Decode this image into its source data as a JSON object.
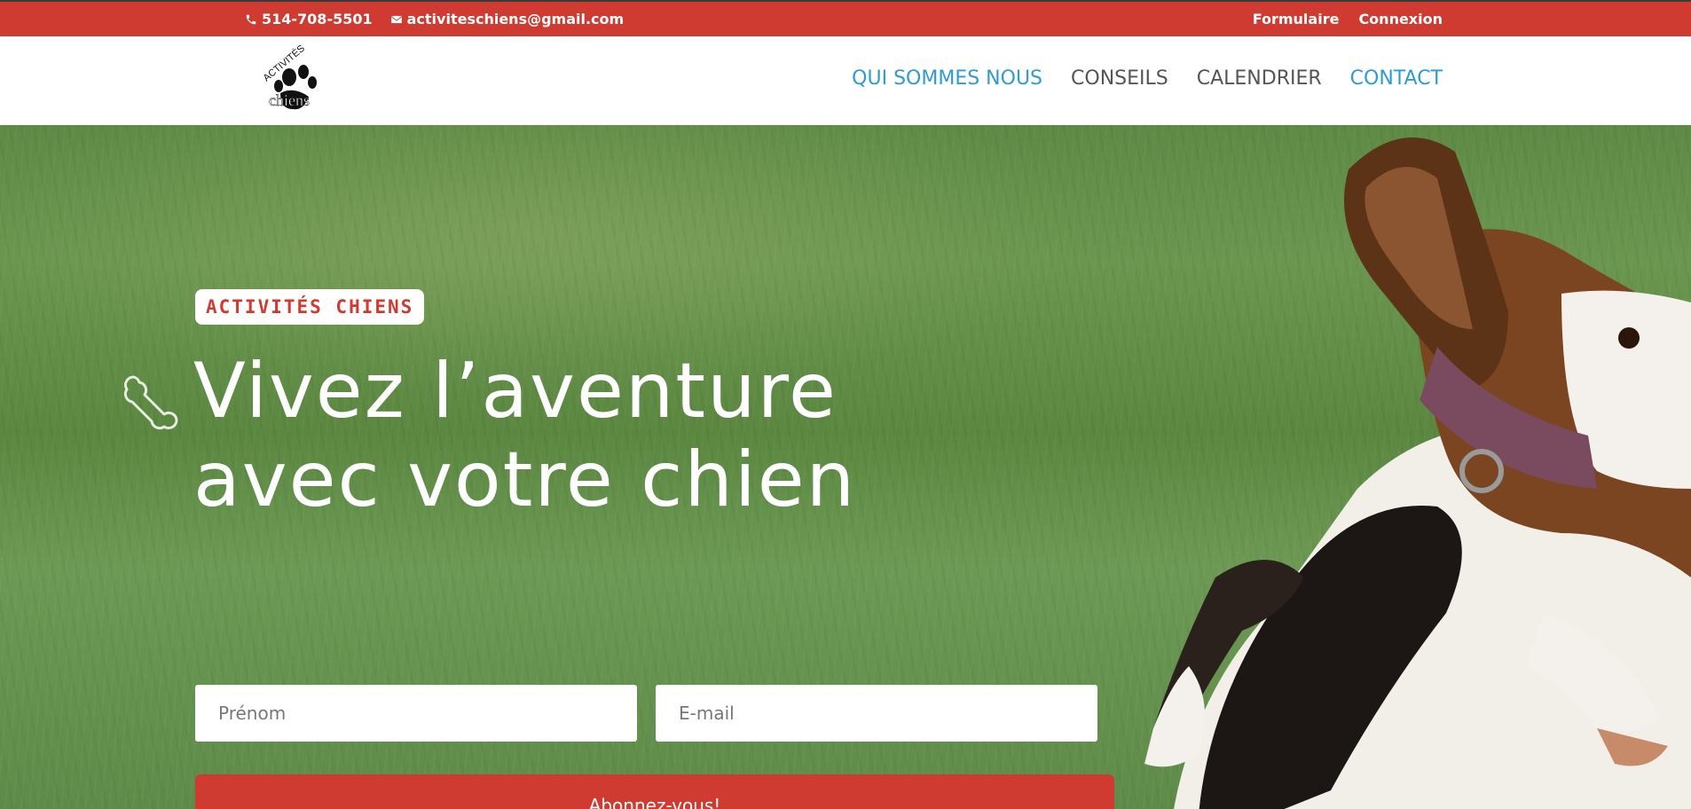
{
  "topbar": {
    "phone": "514-708-5501",
    "email": "activiteschiens@gmail.com",
    "links": [
      "Formulaire",
      "Connexion"
    ]
  },
  "header": {
    "logo_text_top": "ACTIVITÉS",
    "logo_text_bottom": "chiens",
    "nav": [
      "QUI SOMMES NOUS",
      "CONSEILS",
      "CALENDRIER",
      "CONTACT"
    ]
  },
  "hero": {
    "badge": "ACTIVITÉS CHIENS",
    "headline": "Vivez l’aventure avec votre chien",
    "first_name_placeholder": "Prénom",
    "email_placeholder": "E-mail",
    "subscribe_label": "Abonnez-vous!"
  },
  "colors": {
    "brand_red": "#cf3a31",
    "nav_active": "#2e9ad6"
  }
}
